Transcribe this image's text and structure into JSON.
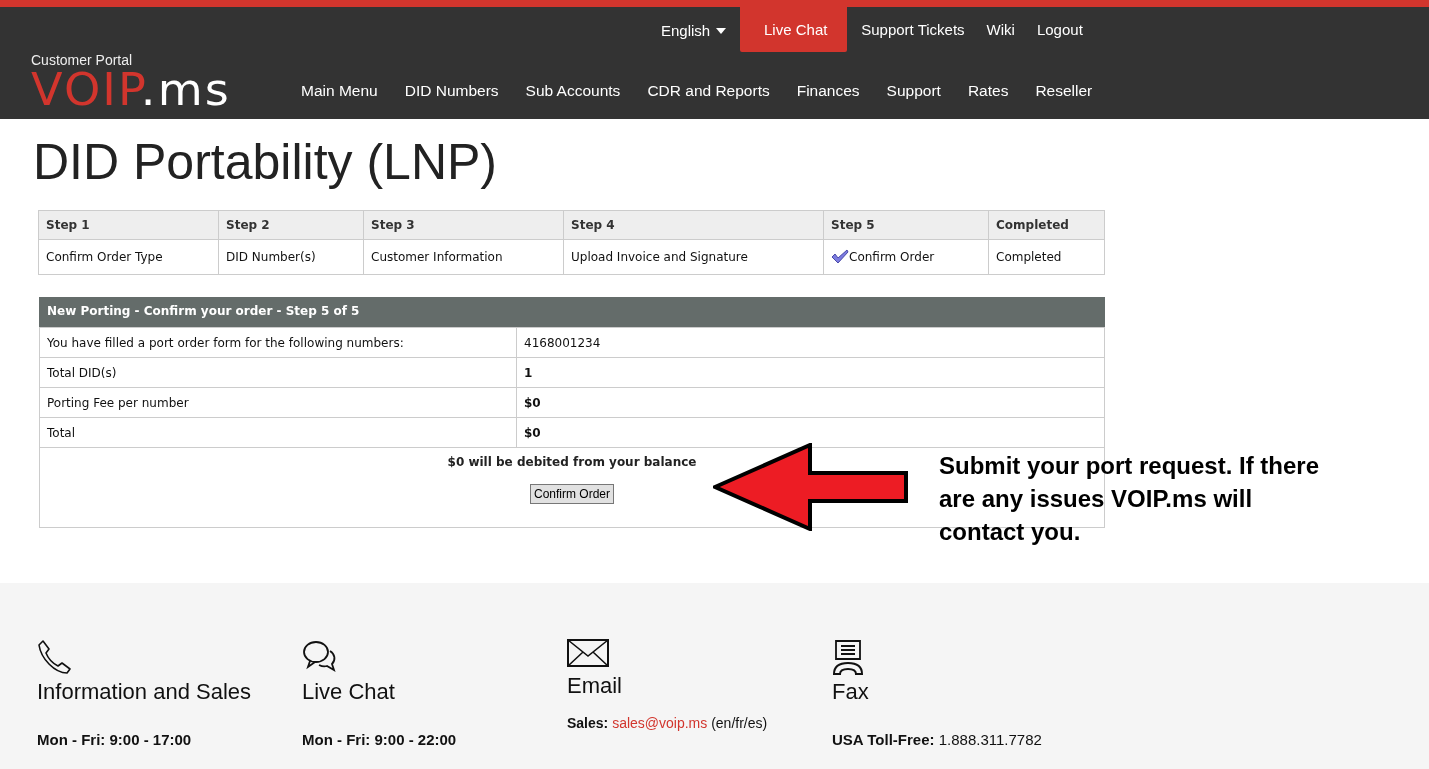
{
  "header": {
    "language": "English",
    "top_links": [
      {
        "label": "Live Chat",
        "highlighted": true
      },
      {
        "label": "Support Tickets",
        "highlighted": false
      },
      {
        "label": "Wiki",
        "highlighted": false
      },
      {
        "label": "Logout",
        "highlighted": false
      }
    ],
    "logo": {
      "caption": "Customer Portal",
      "brand": "VOIP",
      "suffix": ".ms"
    },
    "nav": [
      "Main Menu",
      "DID Numbers",
      "Sub Accounts",
      "CDR and Reports",
      "Finances",
      "Support",
      "Rates",
      "Reseller"
    ]
  },
  "title": "DID Portability (LNP)",
  "steps": [
    {
      "heading": "Step 1",
      "label": "Confirm Order Type",
      "current": false
    },
    {
      "heading": "Step 2",
      "label": "DID Number(s)",
      "current": false
    },
    {
      "heading": "Step 3",
      "label": "Customer Information",
      "current": false
    },
    {
      "heading": "Step 4",
      "label": "Upload Invoice and Signature",
      "current": false
    },
    {
      "heading": "Step 5",
      "label": "Confirm Order",
      "current": true
    },
    {
      "heading": "Completed",
      "label": "Completed",
      "current": false
    }
  ],
  "order": {
    "heading": "New Porting - Confirm your order - Step 5 of 5",
    "rows": [
      {
        "label": "You have filled a port order form for the following numbers:",
        "value": "4168001234",
        "bold": false
      },
      {
        "label": "Total DID(s)",
        "value": "1",
        "bold": true
      },
      {
        "label": "Porting Fee per number",
        "value": "$0",
        "bold": true
      },
      {
        "label": "Total",
        "value": "$0",
        "bold": true
      }
    ],
    "notice": "$0 will be debited from your balance",
    "button": "Confirm Order"
  },
  "callout": "Submit your port request. If there are any issues VOIP.ms will contact you.",
  "footer": [
    {
      "kind": "phone",
      "title": "Information and Sales",
      "lines": [
        {
          "label": "Mon - Fri: 9:00 - 17:00"
        }
      ]
    },
    {
      "kind": "chat",
      "title": "Live Chat",
      "lines": [
        {
          "label": "Mon - Fri: 9:00 - 22:00"
        }
      ]
    },
    {
      "kind": "email",
      "title": "Email",
      "lines": [
        {
          "label": "Sales:",
          "link": "sales@voip.ms",
          "text": "(en/fr/es)"
        }
      ]
    },
    {
      "kind": "fax",
      "title": "Fax",
      "lines": [
        {
          "label": "USA Toll-Free:",
          "text": "1.888.311.7782"
        }
      ]
    }
  ]
}
